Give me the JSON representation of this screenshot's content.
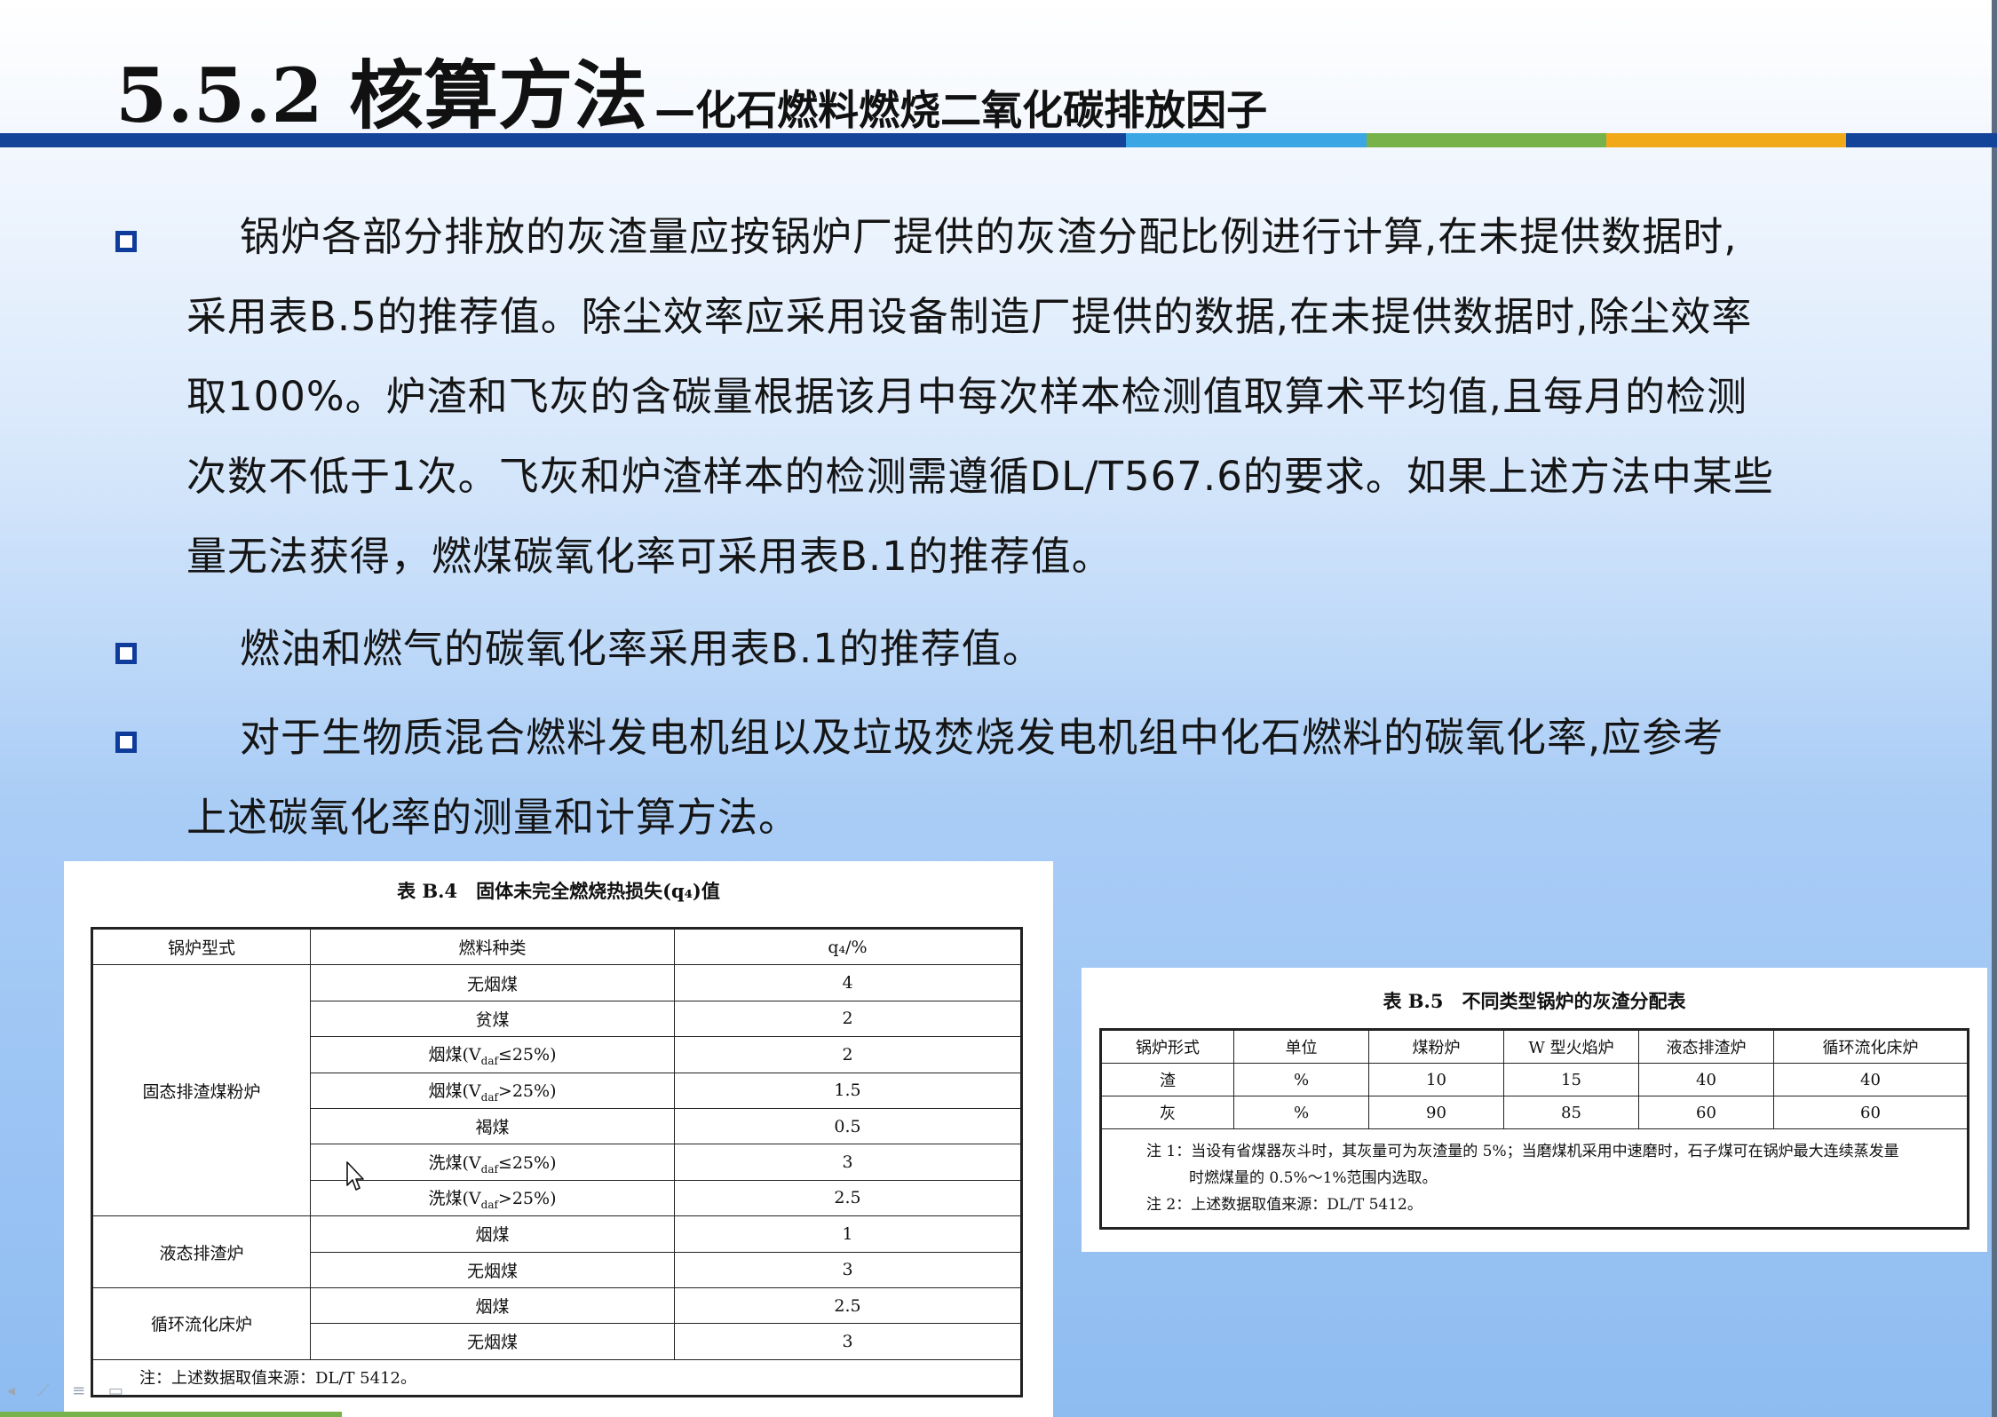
{
  "slide": {
    "title_main": "5.5.2  核算方法",
    "title_sub": "—化石燃料燃烧二氧化碳排放因子",
    "bullets": [
      {
        "lines": [
          "锅炉各部分排放的灰渣量应按锅炉厂提供的灰渣分配比例进行计算,在未提供数据时,",
          "采用表B.5的推荐值。除尘效率应采用设备制造厂提供的数据,在未提供数据时,除尘效率",
          "取100%。炉渣和飞灰的含碳量根据该月中每次样本检测值取算术平均值,且每月的检测",
          "次数不低于1次。飞灰和炉渣样本的检测需遵循DL/T567.6的要求。如果上述方法中某些",
          "量无法获得，燃煤碳氧化率可采用表B.1的推荐值。"
        ]
      },
      {
        "lines": [
          "燃油和燃气的碳氧化率采用表B.1的推荐值。"
        ]
      },
      {
        "lines": [
          "对于生物质混合燃料发电机组以及垃圾焚烧发电机组中化石燃料的碳氧化率,应参考",
          "上述碳氧化率的测量和计算方法。"
        ]
      }
    ]
  },
  "table_b4": {
    "caption": "表 B.4　固体未完全燃烧热损失(q₄)值",
    "headers": [
      "锅炉型式",
      "燃料种类",
      "q₄/%"
    ],
    "groups": [
      {
        "type": "固态排渣煤粉炉",
        "rows": [
          {
            "fuel": "无烟煤",
            "value": "4"
          },
          {
            "fuel": "贫煤",
            "value": "2"
          },
          {
            "fuel": "烟煤(V",
            "sub": "daf",
            "tail": "≤25%)",
            "value": "2"
          },
          {
            "fuel": "烟煤(V",
            "sub": "daf",
            "tail": ">25%)",
            "value": "1.5"
          },
          {
            "fuel": "褐煤",
            "value": "0.5"
          },
          {
            "fuel": "洗煤(V",
            "sub": "daf",
            "tail": "≤25%)",
            "value": "3"
          },
          {
            "fuel": "洗煤(V",
            "sub": "daf",
            "tail": ">25%)",
            "value": "2.5"
          }
        ]
      },
      {
        "type": "液态排渣炉",
        "rows": [
          {
            "fuel": "烟煤",
            "value": "1"
          },
          {
            "fuel": "无烟煤",
            "value": "3"
          }
        ]
      },
      {
        "type": "循环流化床炉",
        "rows": [
          {
            "fuel": "烟煤",
            "value": "2.5"
          },
          {
            "fuel": "无烟煤",
            "value": "3"
          }
        ]
      }
    ],
    "note": "注：上述数据取值来源：DL/T 5412。"
  },
  "table_b5": {
    "caption": "表 B.5　不同类型锅炉的灰渣分配表",
    "headers": [
      "锅炉形式",
      "单位",
      "煤粉炉",
      "W 型火焰炉",
      "液态排渣炉",
      "循环流化床炉"
    ],
    "rows": [
      [
        "渣",
        "%",
        "10",
        "15",
        "40",
        "40"
      ],
      [
        "灰",
        "%",
        "90",
        "85",
        "60",
        "60"
      ]
    ],
    "notes": [
      "注 1：当设有省煤器灰斗时，其灰量可为灰渣量的 5%；当磨煤机采用中速磨时，石子煤可在锅炉最大连续蒸发量",
      "时燃煤量的 0.5%～1%范围内选取。",
      "注 2：上述数据取值来源：DL/T 5412。"
    ]
  },
  "colors": {
    "title_bar": [
      "#14439a",
      "#3aa6e3",
      "#78b24a",
      "#f1a91a",
      "#14439a"
    ],
    "bullet": "#0f3c9b"
  },
  "icons": {
    "bullet": "hollow-square-bullet-icon",
    "cursor": "mouse-pointer-icon",
    "nav": "slide-nav-icons"
  }
}
